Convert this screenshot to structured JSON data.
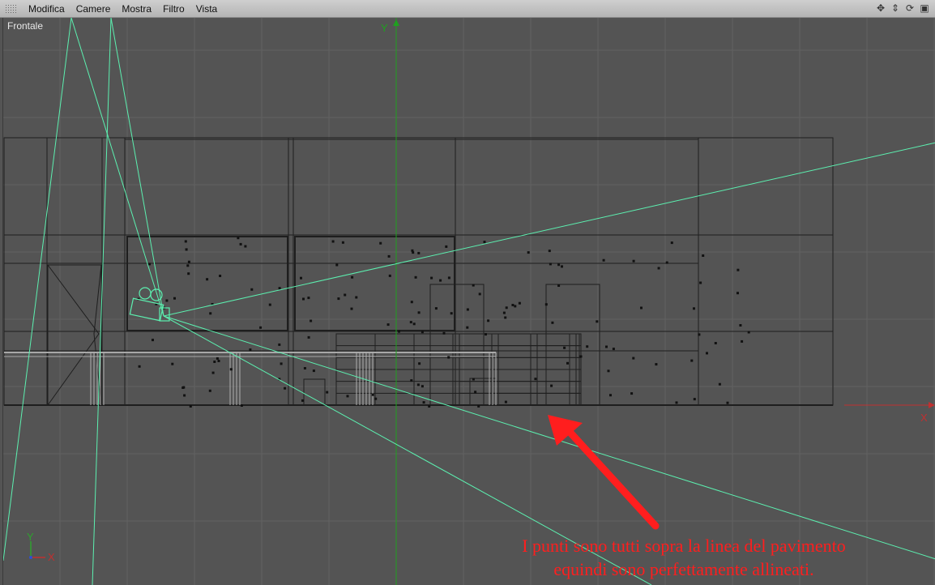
{
  "menu": {
    "items": [
      "Modifica",
      "Camere",
      "Mostra",
      "Filtro",
      "Vista"
    ]
  },
  "nav_icons": [
    "move-icon",
    "zoom-icon",
    "rotate-icon",
    "maximize-icon"
  ],
  "viewport": {
    "label": "Frontale"
  },
  "axes": {
    "y_label": "Y",
    "x_label": "X",
    "gizmo_y": "Y",
    "gizmo_x": "X"
  },
  "annotation": {
    "line1": "I punti sono tutti sopra la linea del pavimento",
    "line2": "equindi sono perfettamente allineati."
  },
  "colors": {
    "background": "#545454",
    "grid": "#626262",
    "wire": "#1e1e1e",
    "camera": "#5cf0b0",
    "y_axis": "#1fa01f",
    "x_axis": "#c03030",
    "annotation": "#ff1e1e"
  }
}
